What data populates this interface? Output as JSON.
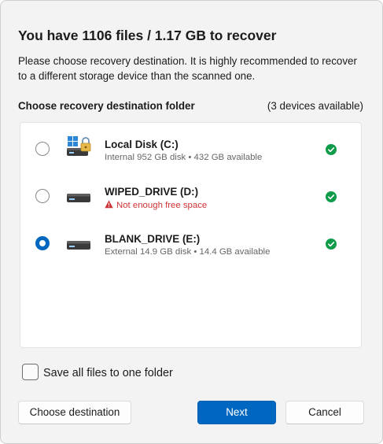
{
  "dialog": {
    "title": "You have 1106 files / 1.17 GB to recover",
    "description": "Please choose recovery destination. It is highly recommended to recover to a different storage device than the scanned one."
  },
  "destination": {
    "section_label": "Choose recovery destination folder",
    "devices_count": "(3 devices available)",
    "drives": [
      {
        "name": "Local Disk (C:)",
        "detail": "Internal 952 GB disk • 432 GB available",
        "icon": "system-drive-locked-icon",
        "selected": false,
        "status": "ok"
      },
      {
        "name": "WIPED_DRIVE (D:)",
        "detail": "Not enough free space",
        "icon": "hard-drive-icon",
        "selected": false,
        "status": "warning"
      },
      {
        "name": "BLANK_DRIVE (E:)",
        "detail": "External 14.9 GB disk • 14.4 GB available",
        "icon": "hard-drive-icon",
        "selected": true,
        "status": "ok"
      }
    ]
  },
  "options": {
    "save_all_label": "Save all files to one folder",
    "save_all_checked": false
  },
  "buttons": {
    "choose_destination": "Choose destination",
    "next": "Next",
    "cancel": "Cancel"
  },
  "colors": {
    "accent": "#0067c0",
    "ok_green": "#0f9b4a",
    "warning_red": "#d13438",
    "background": "#f3f3f3"
  }
}
